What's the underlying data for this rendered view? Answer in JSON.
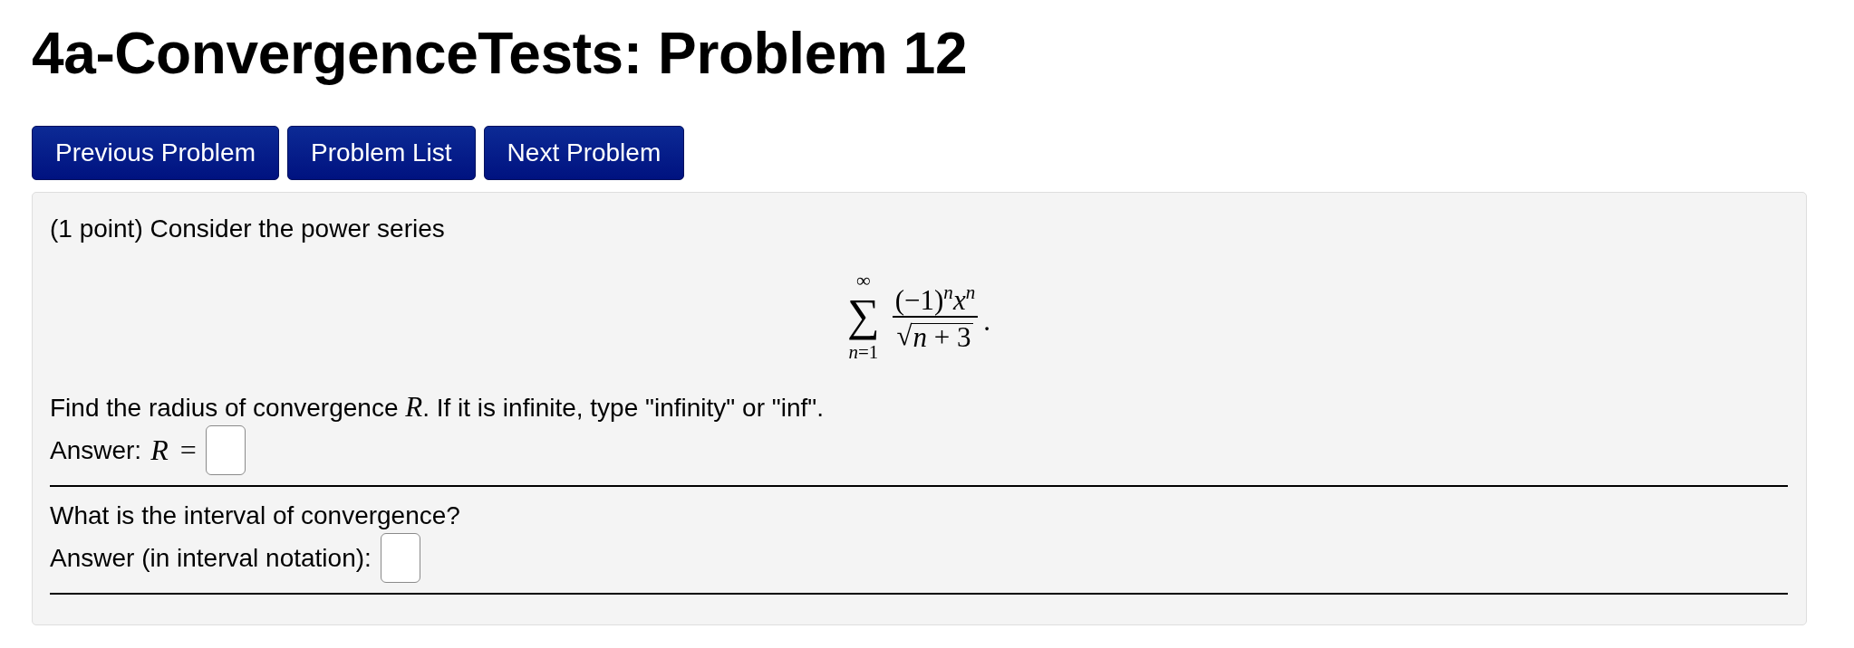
{
  "page": {
    "title": "4a-ConvergenceTests: Problem 12"
  },
  "nav_buttons": [
    {
      "label": "Previous Problem"
    },
    {
      "label": "Problem List"
    },
    {
      "label": "Next Problem"
    }
  ],
  "problem": {
    "intro": "(1 point) Consider the power series",
    "formula": {
      "upper_limit": "∞",
      "sum_symbol": "∑",
      "lower_limit": "*n*=1",
      "numerator": "(−1)$^{n}$*x*$^{n}$",
      "radical": "√",
      "radicand": "*n* + 3",
      "period": "."
    },
    "questions": [
      {
        "prompt": "Find the radius of convergence *R*. If it is infinite, type \"infinity\" or \"inf\".",
        "answer_label": "Answer:",
        "answer_math": "*R* ="
      },
      {
        "prompt": "What is the interval of convergence?",
        "answer_label": "Answer (in interval notation):"
      }
    ]
  }
}
